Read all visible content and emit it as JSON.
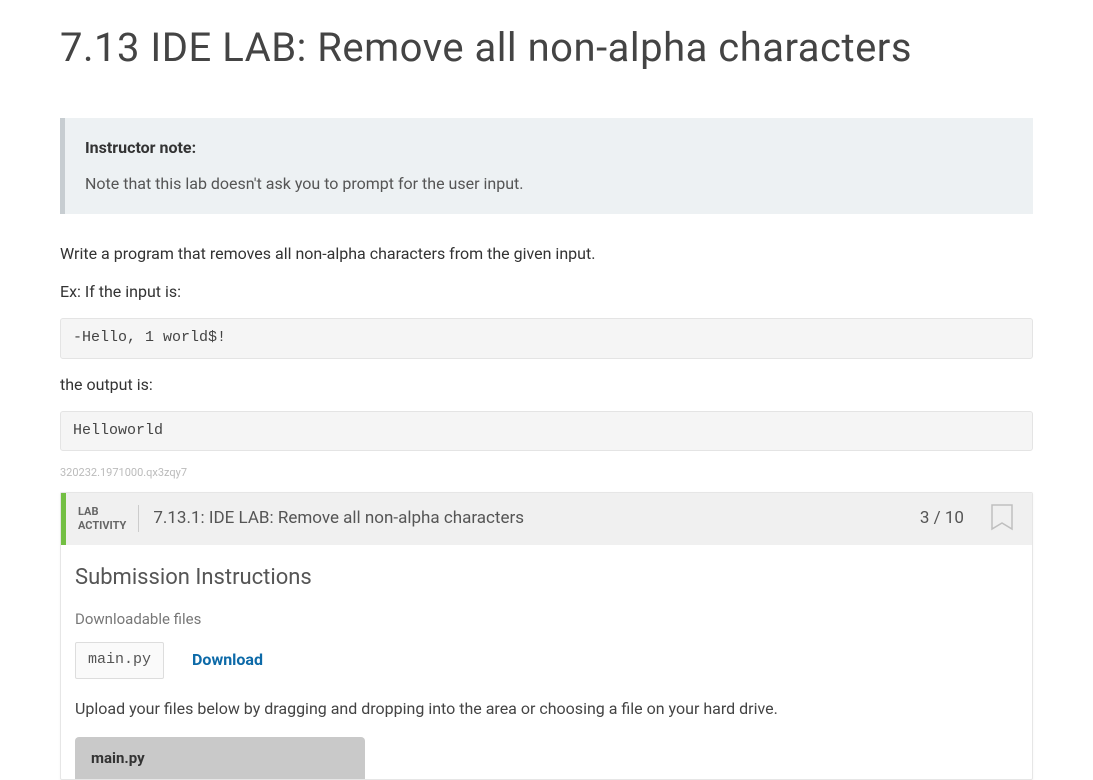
{
  "page": {
    "title": "7.13 IDE LAB: Remove all non-alpha characters"
  },
  "instructor_note": {
    "label": "Instructor note:",
    "body": "Note that this lab doesn't ask you to prompt for the user input."
  },
  "prompt": {
    "line1": "Write a program that removes all non-alpha characters from the given input.",
    "line2": "Ex: If the input is:",
    "example_input": "-Hello, 1 world$!",
    "line3": "the output is:",
    "example_output": "Helloworld"
  },
  "hash_id": "320232.1971000.qx3zqy7",
  "lab": {
    "label_line1": "LAB",
    "label_line2": "ACTIVITY",
    "title": "7.13.1: IDE LAB: Remove all non-alpha characters",
    "score": "3 / 10"
  },
  "submission": {
    "heading": "Submission Instructions",
    "downloadable_label": "Downloadable files",
    "file_name": "main.py",
    "download_label": "Download",
    "upload_instructions": "Upload your files below by dragging and dropping into the area or choosing a file on your hard drive.",
    "upload_tab": "main.py"
  }
}
